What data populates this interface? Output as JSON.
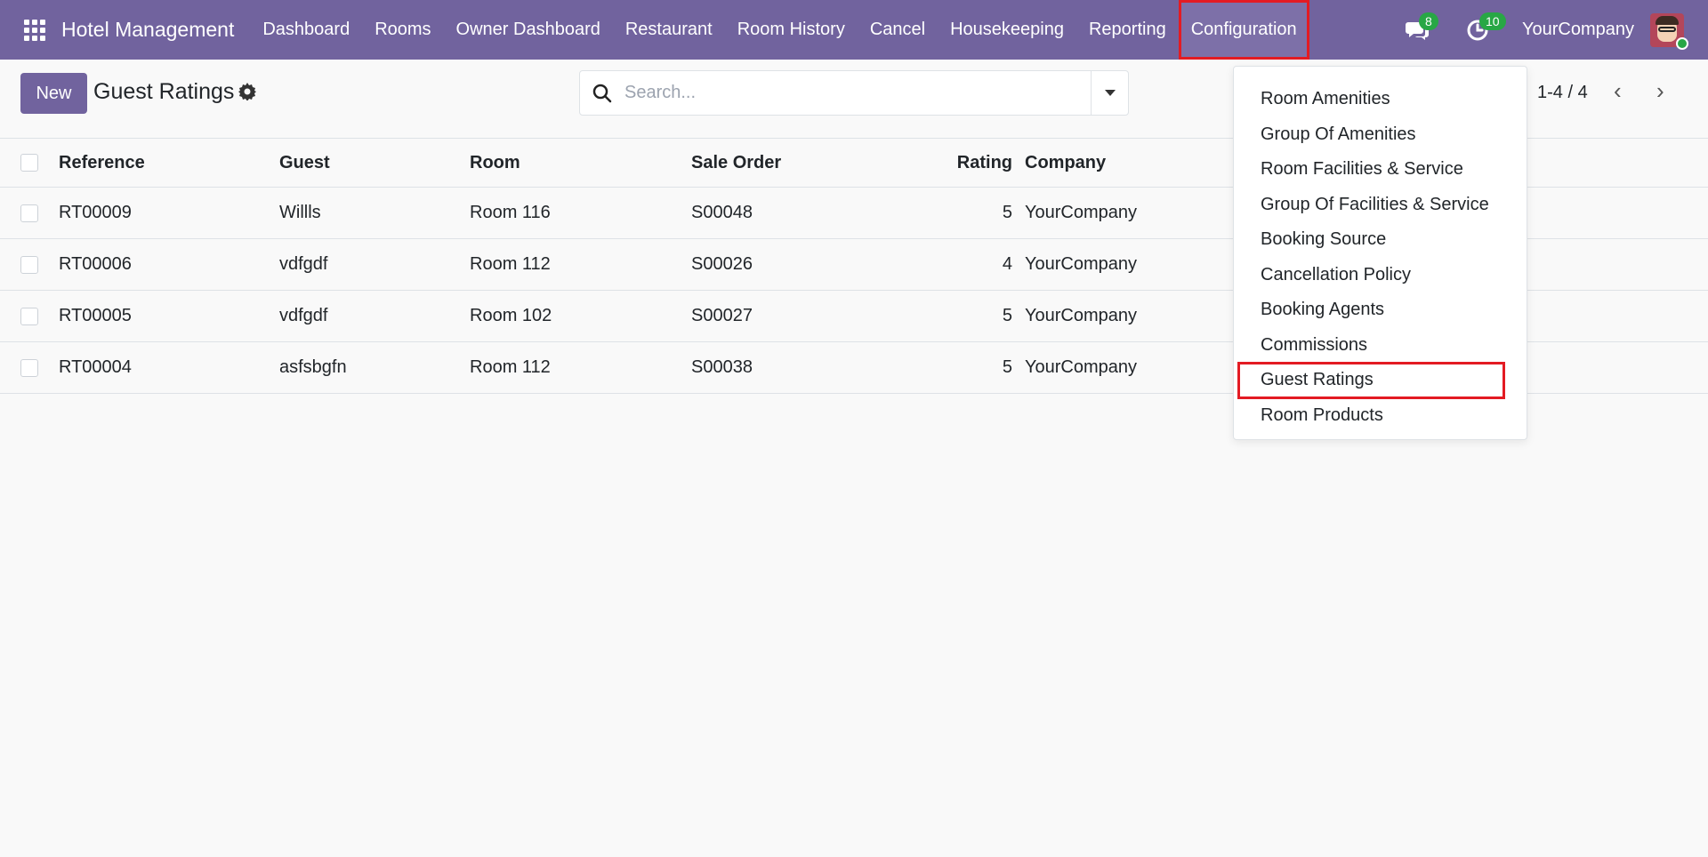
{
  "navbar": {
    "app_title": "Hotel Management",
    "menu": [
      {
        "label": "Dashboard"
      },
      {
        "label": "Rooms"
      },
      {
        "label": "Owner Dashboard"
      },
      {
        "label": "Restaurant"
      },
      {
        "label": "Room History"
      },
      {
        "label": "Cancel"
      },
      {
        "label": "Housekeeping"
      },
      {
        "label": "Reporting"
      },
      {
        "label": "Configuration",
        "active": true
      }
    ],
    "messages_count": "8",
    "activities_count": "10",
    "company": "YourCompany"
  },
  "control": {
    "new_label": "New",
    "title": "Guest Ratings",
    "search_placeholder": "Search...",
    "pager": "1-4 / 4"
  },
  "table": {
    "headers": {
      "reference": "Reference",
      "guest": "Guest",
      "room": "Room",
      "sale_order": "Sale Order",
      "rating": "Rating",
      "company": "Company"
    },
    "rows": [
      {
        "reference": "RT00009",
        "guest": "Willls",
        "room": "Room 116",
        "sale_order": "S00048",
        "rating": "5",
        "company": "YourCompany"
      },
      {
        "reference": "RT00006",
        "guest": "vdfgdf",
        "room": "Room 112",
        "sale_order": "S00026",
        "rating": "4",
        "company": "YourCompany"
      },
      {
        "reference": "RT00005",
        "guest": "vdfgdf",
        "room": "Room 102",
        "sale_order": "S00027",
        "rating": "5",
        "company": "YourCompany"
      },
      {
        "reference": "RT00004",
        "guest": "asfsbgfn",
        "room": "Room 112",
        "sale_order": "S00038",
        "rating": "5",
        "company": "YourCompany"
      }
    ]
  },
  "dropdown": {
    "items": [
      {
        "label": "Room Amenities"
      },
      {
        "label": "Group Of Amenities"
      },
      {
        "label": "Room Facilities & Service"
      },
      {
        "label": "Group Of Facilities & Service"
      },
      {
        "label": "Booking Source"
      },
      {
        "label": "Cancellation Policy"
      },
      {
        "label": "Booking Agents"
      },
      {
        "label": "Commissions"
      },
      {
        "label": "Guest Ratings",
        "highlighted": true
      },
      {
        "label": "Room Products"
      }
    ]
  },
  "colors": {
    "brand": "#71639e",
    "badge": "#28a745",
    "highlight": "#e31b23"
  }
}
